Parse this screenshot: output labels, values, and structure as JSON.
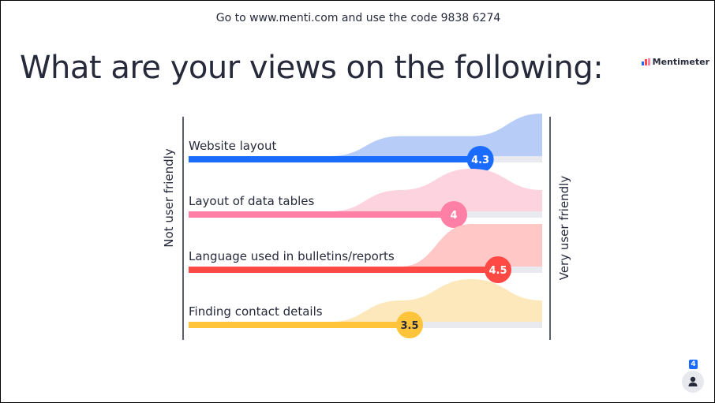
{
  "header": {
    "join_text": "Go to www.menti.com and use the code 9838 6274"
  },
  "slide": {
    "title": "What are your views on the following:"
  },
  "logo": {
    "text": "Mentimeter",
    "icon": "mentimeter-logo-icon"
  },
  "participants": {
    "count": "4",
    "icon": "person-icon"
  },
  "chart_data": {
    "type": "bar",
    "scale_min": 1,
    "scale_max": 5,
    "left_label": "Not user friendly",
    "right_label": "Very user friendly",
    "track_color": "#e9eaef",
    "series": [
      {
        "name": "Website layout",
        "value": 4.3,
        "label": "4.3",
        "color": "#196cff",
        "fill": "#b7cdf8",
        "distribution": [
          0,
          0,
          0,
          0.47,
          0.47,
          1
        ]
      },
      {
        "name": "Layout of data tables",
        "value": 4,
        "label": "4",
        "color": "#ff7fa6",
        "fill": "#fdd3df",
        "distribution": [
          0,
          0,
          0,
          0.5,
          1,
          0.5
        ]
      },
      {
        "name": "Language used in bulletins/reports",
        "value": 4.5,
        "label": "4.5",
        "color": "#ff4945",
        "fill": "#ffc8c6",
        "distribution": [
          0,
          0,
          0,
          0,
          1,
          1
        ]
      },
      {
        "name": "Finding contact details",
        "value": 3.5,
        "label": "3.5",
        "color": "#ffc43a",
        "fill": "#fde8bb",
        "distribution": [
          0,
          0,
          0,
          0.5,
          1,
          0.5
        ]
      }
    ]
  }
}
